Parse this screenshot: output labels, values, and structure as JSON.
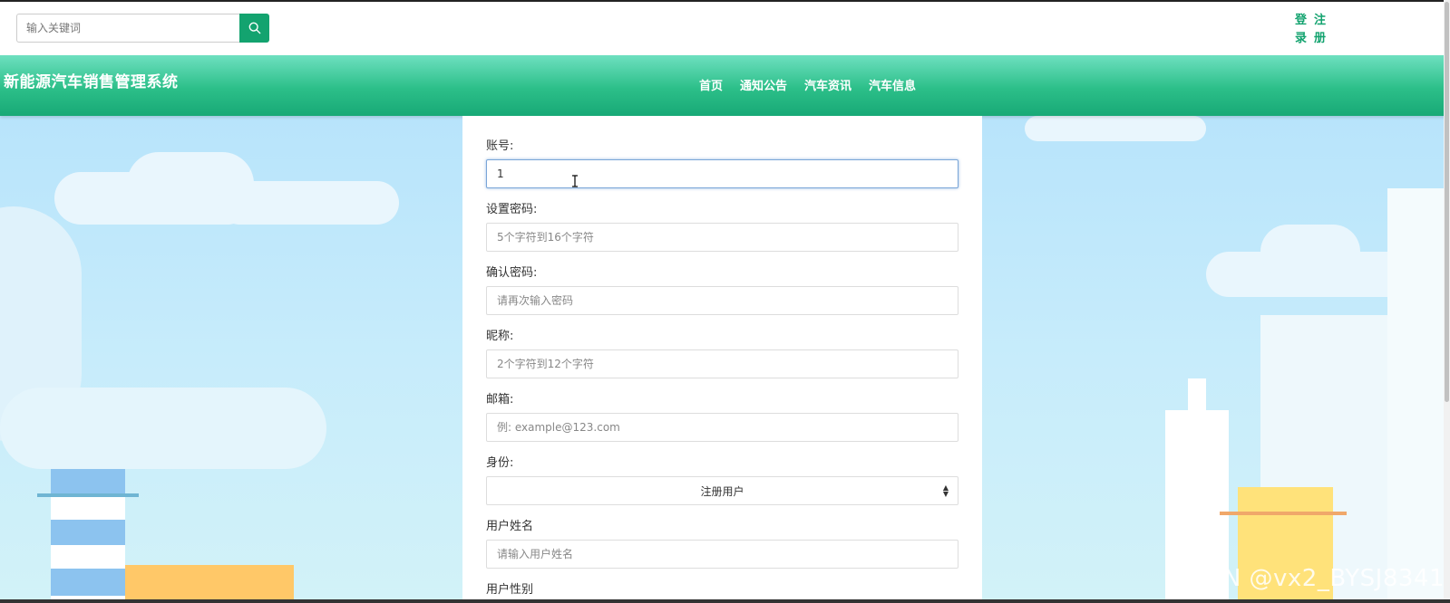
{
  "search": {
    "placeholder": "输入关键词",
    "button_icon": "search-icon"
  },
  "auth": {
    "login_label_chars": [
      "登",
      "录"
    ],
    "register_label_chars": [
      "注",
      "册"
    ]
  },
  "header": {
    "site_title": "新能源汽车销售管理系统",
    "nav": [
      "首页",
      "通知公告",
      "汽车资讯",
      "汽车信息"
    ]
  },
  "form": {
    "account": {
      "label": "账号:",
      "value": "1"
    },
    "password": {
      "label": "设置密码:",
      "placeholder": "5个字符到16个字符"
    },
    "confirm_password": {
      "label": "确认密码:",
      "placeholder": "请再次输入密码"
    },
    "nickname": {
      "label": "昵称:",
      "placeholder": "2个字符到12个字符"
    },
    "email": {
      "label": "邮箱:",
      "placeholder": "例: example@123.com"
    },
    "identity": {
      "label": "身份:",
      "selected": "注册用户"
    },
    "user_name": {
      "label": "用户姓名",
      "placeholder": "请输入用户姓名"
    },
    "next_label_partial": "用户性别"
  },
  "watermark": "CSDN @vx2_BYSJ8341",
  "colors": {
    "accent": "#13a36f",
    "header_top": "#6ee0c0",
    "header_bottom": "#18a976",
    "sky": "#c7ecfb"
  }
}
